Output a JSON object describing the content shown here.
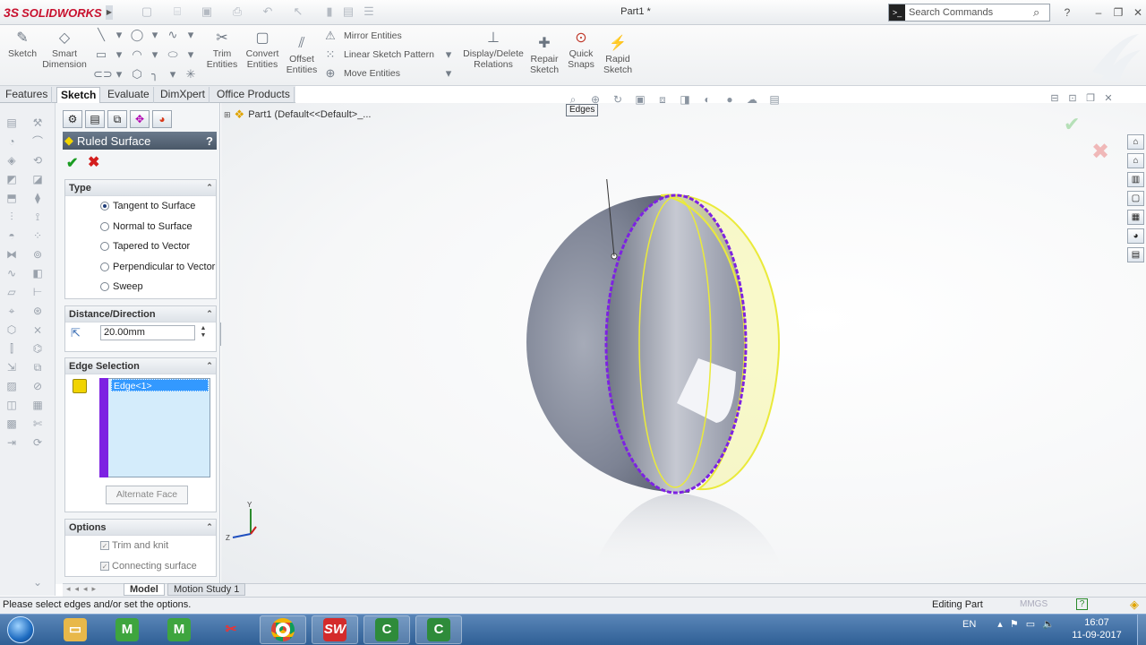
{
  "app": {
    "brand": "SOLIDWORKS",
    "brand_mark": "3S",
    "doc_title": "Part1 *",
    "search_placeholder": "Search Commands"
  },
  "titlebar": {
    "icons": [
      "new-doc-icon",
      "open-icon",
      "save-icon",
      "print-icon",
      "undo-icon",
      "select-icon",
      "rebuild-icon",
      "file-properties-icon",
      "options-icon"
    ]
  },
  "ribbon": {
    "sketch": "Sketch",
    "smart_dimension": [
      "Smart",
      "Dimension"
    ],
    "trim": [
      "Trim",
      "Entities"
    ],
    "convert": [
      "Convert",
      "Entities"
    ],
    "offset": [
      "Offset",
      "Entities"
    ],
    "mirror": "Mirror Entities",
    "linear_pattern": "Linear Sketch Pattern",
    "move": "Move Entities",
    "display_delete": [
      "Display/Delete",
      "Relations"
    ],
    "repair": [
      "Repair",
      "Sketch"
    ],
    "quick_snaps": [
      "Quick",
      "Snaps"
    ],
    "rapid_sketch": [
      "Rapid",
      "Sketch"
    ]
  },
  "tabs": [
    "Features",
    "Sketch",
    "Evaluate",
    "DimXpert",
    "Office Products"
  ],
  "active_tab": "Sketch",
  "tree": {
    "root": "Part1  (Default<<Default>_..."
  },
  "property_manager": {
    "title": "Ruled Surface",
    "help": "?",
    "type_group": {
      "title": "Type",
      "options": [
        "Tangent to Surface",
        "Normal to Surface",
        "Tapered to Vector",
        "Perpendicular to Vector",
        "Sweep"
      ],
      "selected": "Tangent to Surface"
    },
    "distance_group": {
      "title": "Distance/Direction",
      "value": "20.00mm"
    },
    "edge_group": {
      "title": "Edge Selection",
      "items": [
        "Edge<1>"
      ],
      "alternate_face": "Alternate Face"
    },
    "options_group": {
      "title": "Options",
      "trim_and_knit": "Trim and knit",
      "connecting_surface": "Connecting surface",
      "trim_checked": true,
      "connecting_checked": true
    }
  },
  "viewport": {
    "tooltip": "Edges",
    "triad": {
      "y": "Y",
      "z": "Z"
    }
  },
  "bottom_tabs": [
    "Model",
    "Motion Study 1"
  ],
  "status": {
    "message": "Please select edges and/or set the options.",
    "mode": "Editing Part",
    "units": "MMGS"
  },
  "taskbar": {
    "apps": [
      "explorer",
      "camtasia-recorder",
      "camtasia-studio",
      "snipping-tool",
      "chrome",
      "solidworks",
      "camtasia-c",
      "camtasia-c2"
    ],
    "lang": "EN",
    "time": "16:07",
    "date": "11-09-2017"
  },
  "colors": {
    "accent": "#7d22e2",
    "preview": "#f1f06a",
    "ok": "#1a9c22",
    "cancel": "#d31d1d",
    "brand": "#c8102e"
  }
}
